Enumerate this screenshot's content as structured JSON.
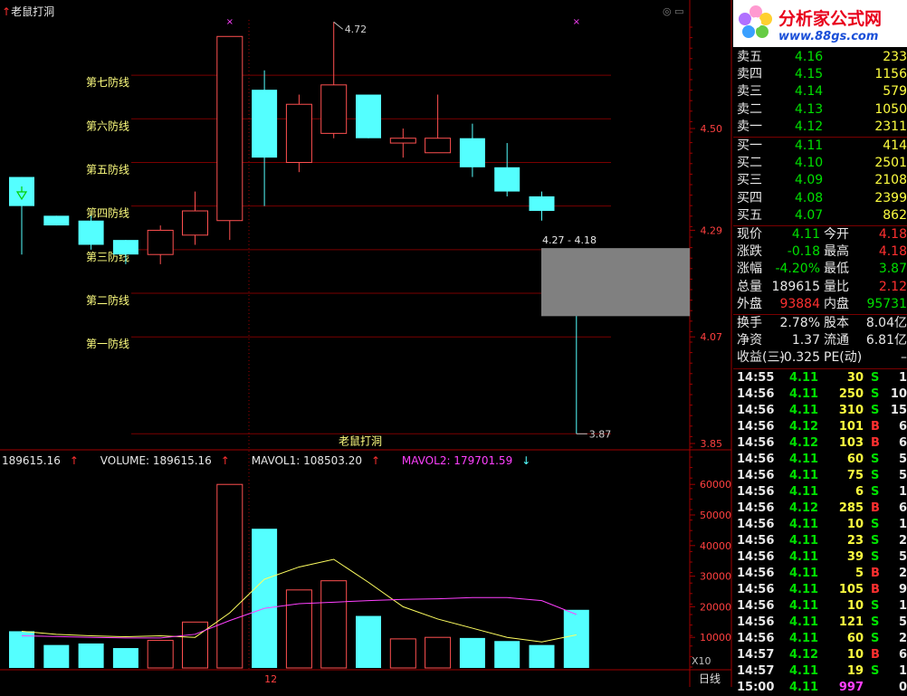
{
  "window": {
    "indicator_title": "老鼠打洞",
    "period_label": "日线",
    "x_axis_label": "12",
    "scale_label": "X10"
  },
  "colors": {
    "up": "#ff5050",
    "down": "#54ffff",
    "grid": "#7a0000",
    "label": "#ffff80",
    "mavol1": "#ffff60",
    "mavol2": "#ff40ff"
  },
  "defense_lines": [
    {
      "label": "第七防线",
      "price": 4.61
    },
    {
      "label": "第六防线",
      "price": 4.52
    },
    {
      "label": "第五防线",
      "price": 4.43
    },
    {
      "label": "第四防线",
      "price": 4.34
    },
    {
      "label": "第三防线",
      "price": 4.25
    },
    {
      "label": "第二防线",
      "price": 4.16
    },
    {
      "label": "第一防线",
      "price": 4.07
    },
    {
      "label": "老鼠打洞",
      "price": 3.87
    }
  ],
  "annotations": {
    "high_label": "4.72",
    "low_label": "3.87",
    "range_label": "4.27 - 4.18"
  },
  "chart_data": [
    {
      "type": "candlestick",
      "title": "老鼠打洞",
      "y_axis_ticks": [
        "4.50",
        "4.29",
        "4.07",
        "3.85"
      ],
      "ylim": [
        3.82,
        4.81
      ],
      "candles": [
        {
          "open": 4.4,
          "close": 4.34,
          "high": 4.4,
          "low": 4.24
        },
        {
          "open": 4.32,
          "close": 4.3,
          "high": 4.32,
          "low": 4.3
        },
        {
          "open": 4.31,
          "close": 4.26,
          "high": 4.32,
          "low": 4.25
        },
        {
          "open": 4.27,
          "close": 4.24,
          "high": 4.27,
          "low": 4.22
        },
        {
          "open": 4.24,
          "close": 4.29,
          "high": 4.3,
          "low": 4.22
        },
        {
          "open": 4.28,
          "close": 4.33,
          "high": 4.37,
          "low": 4.26
        },
        {
          "open": 4.31,
          "close": 4.69,
          "high": 4.69,
          "low": 4.27
        },
        {
          "open": 4.58,
          "close": 4.44,
          "high": 4.62,
          "low": 4.34
        },
        {
          "open": 4.43,
          "close": 4.55,
          "high": 4.57,
          "low": 4.41
        },
        {
          "open": 4.49,
          "close": 4.59,
          "high": 4.72,
          "low": 4.48
        },
        {
          "open": 4.57,
          "close": 4.48,
          "high": 4.57,
          "low": 4.48
        },
        {
          "open": 4.47,
          "close": 4.48,
          "high": 4.5,
          "low": 4.44
        },
        {
          "open": 4.45,
          "close": 4.48,
          "high": 4.57,
          "low": 4.45
        },
        {
          "open": 4.48,
          "close": 4.42,
          "high": 4.51,
          "low": 4.4
        },
        {
          "open": 4.42,
          "close": 4.37,
          "high": 4.47,
          "low": 4.36
        },
        {
          "open": 4.36,
          "close": 4.33,
          "high": 4.37,
          "low": 4.31
        },
        {
          "open": 4.25,
          "close": 4.18,
          "high": 4.25,
          "low": 3.87
        }
      ],
      "markers": [
        {
          "type": "buy-arrow",
          "candle_index": 0
        }
      ]
    },
    {
      "type": "bar",
      "title": "VOLUME",
      "y_axis_ticks": [
        "60000",
        "50000",
        "40000",
        "30000",
        "20000",
        "10000"
      ],
      "ylim": [
        0,
        64500
      ],
      "legend": {
        "value": "189615.16",
        "volume": "VOLUME: 189615.16",
        "mavol1": "MAVOL1: 108503.20",
        "mavol2": "MAVOL2: 179701.59"
      },
      "values": [
        12000,
        7500,
        8000,
        6500,
        9000,
        15000,
        60000,
        45500,
        25500,
        28500,
        17000,
        9500,
        10000,
        9800,
        8800,
        7500,
        19000
      ],
      "up": [
        false,
        false,
        false,
        false,
        true,
        true,
        true,
        false,
        true,
        true,
        false,
        true,
        true,
        false,
        false,
        false,
        false
      ],
      "mavol1": [
        12000,
        11000,
        10500,
        10200,
        10500,
        10000,
        18000,
        29000,
        33000,
        35500,
        28000,
        20000,
        16000,
        13000,
        10000,
        8500,
        10800
      ],
      "mavol2": [
        10500,
        10300,
        10000,
        9800,
        9800,
        11000,
        15500,
        19500,
        21000,
        21500,
        22000,
        22400,
        22600,
        23000,
        23000,
        22000,
        17500
      ]
    }
  ],
  "quote_panel": {
    "sell": [
      {
        "label": "卖五",
        "price": "4.16",
        "volume": "233"
      },
      {
        "label": "卖四",
        "price": "4.15",
        "volume": "1156"
      },
      {
        "label": "卖三",
        "price": "4.14",
        "volume": "579"
      },
      {
        "label": "卖二",
        "price": "4.13",
        "volume": "1050"
      },
      {
        "label": "卖一",
        "price": "4.12",
        "volume": "2311"
      }
    ],
    "buy": [
      {
        "label": "买一",
        "price": "4.11",
        "volume": "414"
      },
      {
        "label": "买二",
        "price": "4.10",
        "volume": "2501"
      },
      {
        "label": "买三",
        "price": "4.09",
        "volume": "2108"
      },
      {
        "label": "买四",
        "price": "4.08",
        "volume": "2399"
      },
      {
        "label": "买五",
        "price": "4.07",
        "volume": "862"
      }
    ],
    "stats1": [
      {
        "l1": "现价",
        "v1": "4.11",
        "c1": "green",
        "l2": "今开",
        "v2": "4.18",
        "c2": "red"
      },
      {
        "l1": "涨跌",
        "v1": "-0.18",
        "c1": "green",
        "l2": "最高",
        "v2": "4.18",
        "c2": "red"
      },
      {
        "l1": "涨幅",
        "v1": "-4.20%",
        "c1": "green",
        "l2": "最低",
        "v2": "3.87",
        "c2": "green"
      },
      {
        "l1": "总量",
        "v1": "189615",
        "c1": "white",
        "l2": "量比",
        "v2": "2.12",
        "c2": "red"
      },
      {
        "l1": "外盘",
        "v1": "93884",
        "c1": "red",
        "l2": "内盘",
        "v2": "95731",
        "c2": "green"
      }
    ],
    "stats2": [
      {
        "l1": "换手",
        "v1": "2.78%",
        "l2": "股本",
        "v2": "8.04亿"
      },
      {
        "l1": "净资",
        "v1": "1.37",
        "l2": "流通",
        "v2": "6.81亿"
      },
      {
        "l1": "收益(三)",
        "v1": "-0.325",
        "l2": "PE(动)",
        "v2": "–"
      }
    ]
  },
  "ticks": [
    {
      "time": "14:55",
      "price": "4.11",
      "pc": "green",
      "vol": "30",
      "side": "S",
      "extra": "1"
    },
    {
      "time": "14:56",
      "price": "4.11",
      "pc": "green",
      "vol": "250",
      "side": "S",
      "extra": "10"
    },
    {
      "time": "14:56",
      "price": "4.11",
      "pc": "green",
      "vol": "310",
      "side": "S",
      "extra": "15"
    },
    {
      "time": "14:56",
      "price": "4.12",
      "pc": "green",
      "vol": "101",
      "side": "B",
      "extra": "6"
    },
    {
      "time": "14:56",
      "price": "4.12",
      "pc": "green",
      "vol": "103",
      "side": "B",
      "extra": "6"
    },
    {
      "time": "14:56",
      "price": "4.11",
      "pc": "green",
      "vol": "60",
      "side": "S",
      "extra": "5"
    },
    {
      "time": "14:56",
      "price": "4.11",
      "pc": "green",
      "vol": "75",
      "side": "S",
      "extra": "5"
    },
    {
      "time": "14:56",
      "price": "4.11",
      "pc": "green",
      "vol": "6",
      "side": "S",
      "extra": "1"
    },
    {
      "time": "14:56",
      "price": "4.12",
      "pc": "green",
      "vol": "285",
      "side": "B",
      "extra": "6"
    },
    {
      "time": "14:56",
      "price": "4.11",
      "pc": "green",
      "vol": "10",
      "side": "S",
      "extra": "1"
    },
    {
      "time": "14:56",
      "price": "4.11",
      "pc": "green",
      "vol": "23",
      "side": "S",
      "extra": "2"
    },
    {
      "time": "14:56",
      "price": "4.11",
      "pc": "green",
      "vol": "39",
      "side": "S",
      "extra": "5"
    },
    {
      "time": "14:56",
      "price": "4.11",
      "pc": "green",
      "vol": "5",
      "side": "B",
      "extra": "2"
    },
    {
      "time": "14:56",
      "price": "4.11",
      "pc": "green",
      "vol": "105",
      "side": "B",
      "extra": "9"
    },
    {
      "time": "14:56",
      "price": "4.11",
      "pc": "green",
      "vol": "10",
      "side": "S",
      "extra": "1"
    },
    {
      "time": "14:56",
      "price": "4.11",
      "pc": "green",
      "vol": "121",
      "side": "S",
      "extra": "5"
    },
    {
      "time": "14:56",
      "price": "4.11",
      "pc": "green",
      "vol": "60",
      "side": "S",
      "extra": "2"
    },
    {
      "time": "14:57",
      "price": "4.12",
      "pc": "green",
      "vol": "10",
      "side": "B",
      "extra": "6"
    },
    {
      "time": "14:57",
      "price": "4.11",
      "pc": "green",
      "vol": "19",
      "side": "S",
      "extra": "1"
    },
    {
      "time": "15:00",
      "price": "4.11",
      "pc": "green",
      "vol": "997",
      "side": "",
      "extra": "0"
    }
  ],
  "logo": {
    "brand": "分析家公式网",
    "url": "www.88gs.com"
  }
}
